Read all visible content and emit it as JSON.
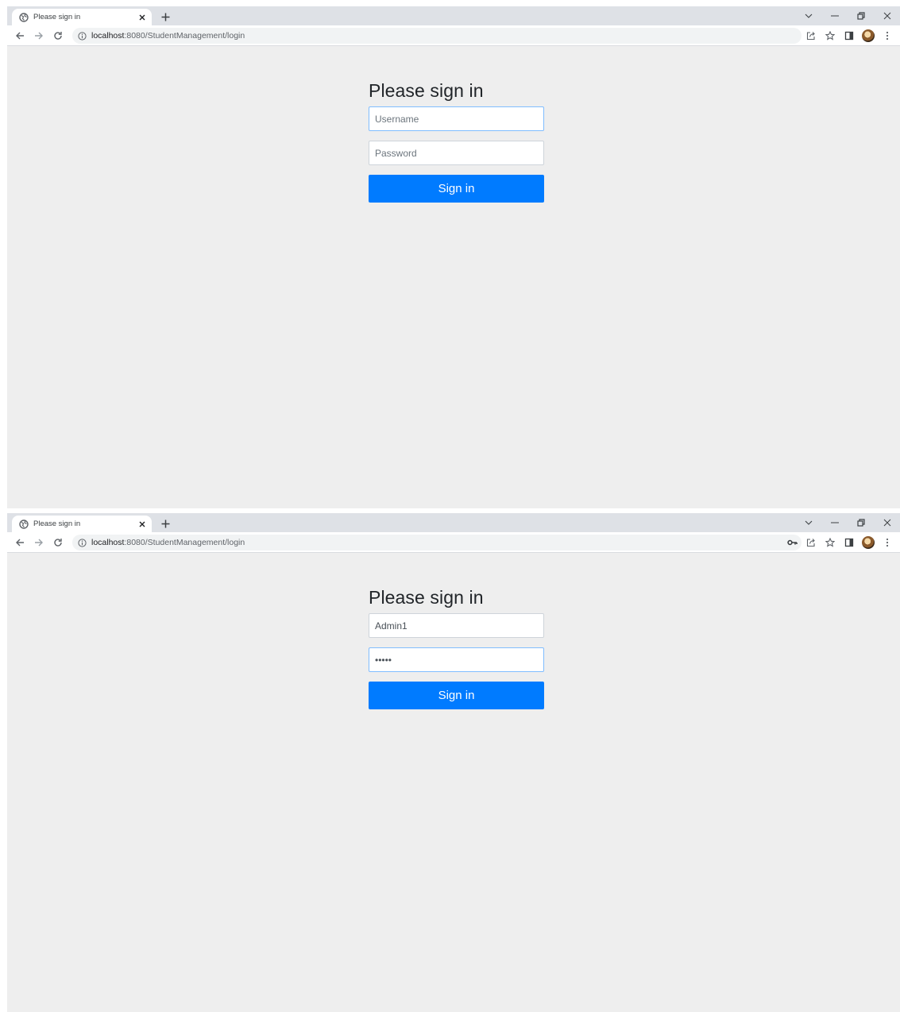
{
  "colors": {
    "primary": "#007bff",
    "page_bg": "#eeeeee",
    "tabstrip": "#dee1e6"
  },
  "windows": [
    {
      "tab": {
        "title": "Please sign in",
        "icon": "globe-icon"
      },
      "address": {
        "host": "localhost",
        "path": ":8080/StudentManagement/login"
      },
      "form": {
        "heading": "Please sign in",
        "username": {
          "value": "",
          "placeholder": "Username"
        },
        "password": {
          "value": "",
          "placeholder": "Password"
        },
        "submit_label": "Sign in"
      }
    },
    {
      "tab": {
        "title": "Please sign in",
        "icon": "globe-icon"
      },
      "address": {
        "host": "localhost",
        "path": ":8080/StudentManagement/login"
      },
      "form": {
        "heading": "Please sign in",
        "username": {
          "value": "Admin1",
          "placeholder": "Username"
        },
        "password": {
          "value": "•••••",
          "placeholder": "Password"
        },
        "submit_label": "Sign in"
      }
    }
  ]
}
